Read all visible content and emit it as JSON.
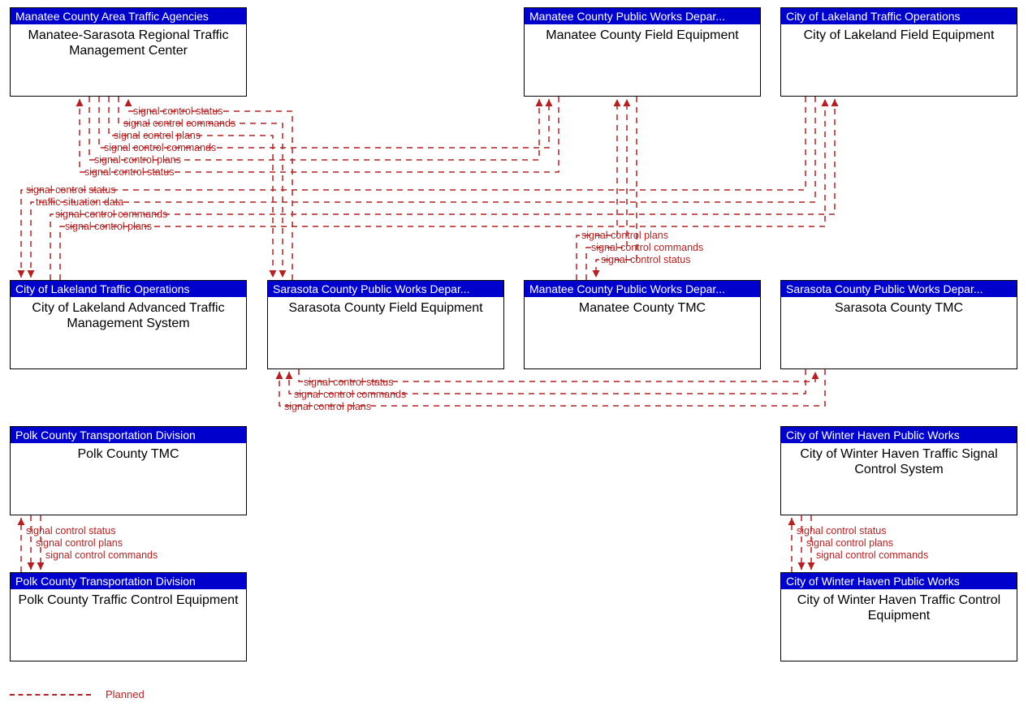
{
  "nodes": {
    "ms_rtmc": {
      "header": "Manatee County Area Traffic Agencies",
      "body": "Manatee-Sarasota Regional Traffic Management Center"
    },
    "man_fe": {
      "header": "Manatee County Public Works Depar...",
      "body": "Manatee County Field Equipment"
    },
    "lakeland_fe": {
      "header": "City of Lakeland Traffic Operations",
      "body": "City of Lakeland Field Equipment"
    },
    "lakeland_atms": {
      "header": "City of Lakeland Traffic Operations",
      "body": "City of Lakeland Advanced Traffic Management System"
    },
    "sarasota_fe": {
      "header": "Sarasota County Public Works Depar...",
      "body": "Sarasota County Field Equipment"
    },
    "manatee_tmc": {
      "header": "Manatee County Public Works Depar...",
      "body": "Manatee County TMC"
    },
    "sarasota_tmc": {
      "header": "Sarasota County Public Works Depar...",
      "body": "Sarasota County TMC"
    },
    "polk_tmc": {
      "header": "Polk County Transportation Division",
      "body": "Polk County TMC"
    },
    "polk_tce": {
      "header": "Polk County Transportation Division",
      "body": "Polk County Traffic Control Equipment"
    },
    "wh_signal": {
      "header": "City of Winter Haven Public Works",
      "body": "City of Winter Haven Traffic Signal Control System"
    },
    "wh_tce": {
      "header": "City of Winter Haven Public Works",
      "body": "City of Winter Haven Traffic Control Equipment"
    }
  },
  "labels": {
    "rtmc_l1": "signal control status",
    "rtmc_l2": "signal control commands",
    "rtmc_l3": "signal control plans",
    "rtmc_l4": "signal control commands",
    "rtmc_l5": "signal control plans",
    "rtmc_l6": "signal control status",
    "atms_l1": "signal control status",
    "atms_l2": "traffic situation data",
    "atms_l3": "signal control commands",
    "atms_l4": "signal control plans",
    "mtmc_l1": "signal control plans",
    "mtmc_l2": "signal control commands",
    "mtmc_l3": "signal control status",
    "stmc_l1": "signal control status",
    "stmc_l2": "signal control commands",
    "stmc_l3": "signal control plans",
    "polk_l1": "signal control status",
    "polk_l2": "signal control plans",
    "polk_l3": "signal control commands",
    "wh_l1": "signal control status",
    "wh_l2": "signal control plans",
    "wh_l3": "signal control commands"
  },
  "legend": {
    "planned": "Planned"
  }
}
